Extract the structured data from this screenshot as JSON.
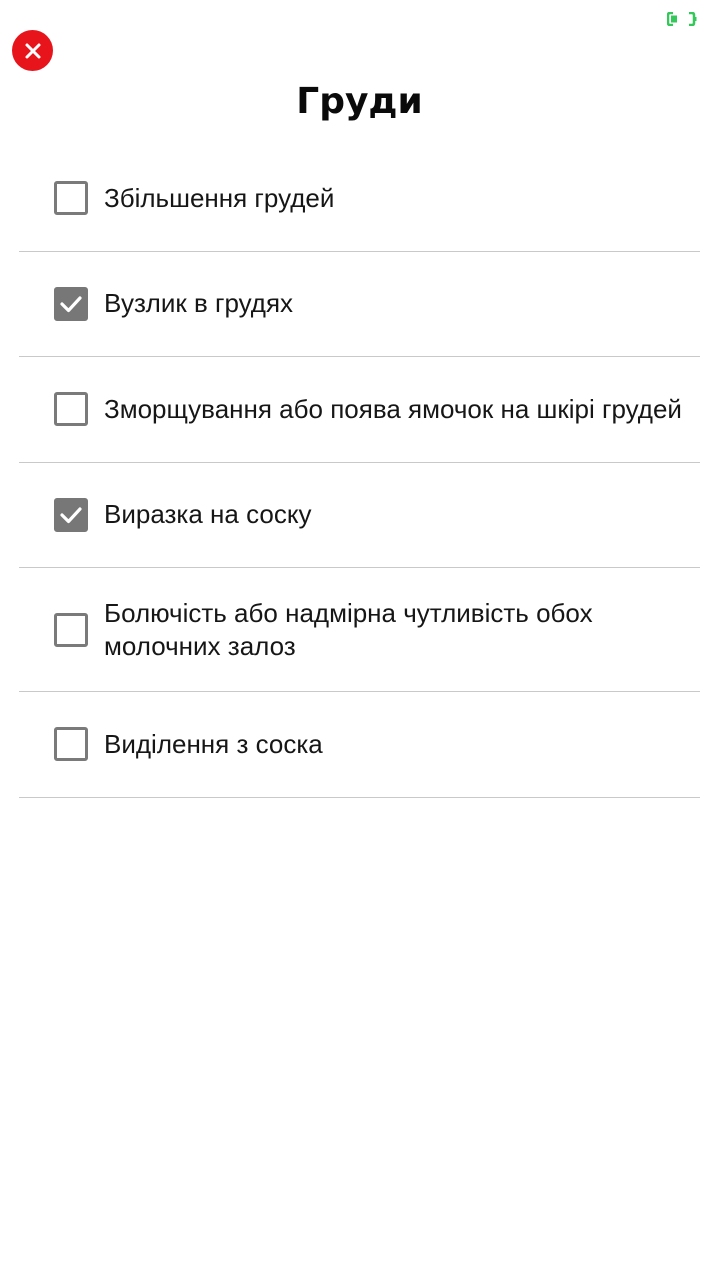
{
  "status": {
    "indicator_color": "#34c759",
    "icon": "battery-indicator-icon"
  },
  "header": {
    "close_icon": "close-icon",
    "close_color": "#e8141b",
    "title": "Груди"
  },
  "items": [
    {
      "label": "Збільшення грудей",
      "checked": false
    },
    {
      "label": "Вузлик в грудях",
      "checked": true
    },
    {
      "label": "Зморщування або поява ямочок на шкірі грудей",
      "checked": false
    },
    {
      "label": "Виразка на соску",
      "checked": true
    },
    {
      "label": "Болючість або надмірна чутливість обох молочних залоз",
      "checked": false
    },
    {
      "label": "Виділення з соска",
      "checked": false
    }
  ]
}
